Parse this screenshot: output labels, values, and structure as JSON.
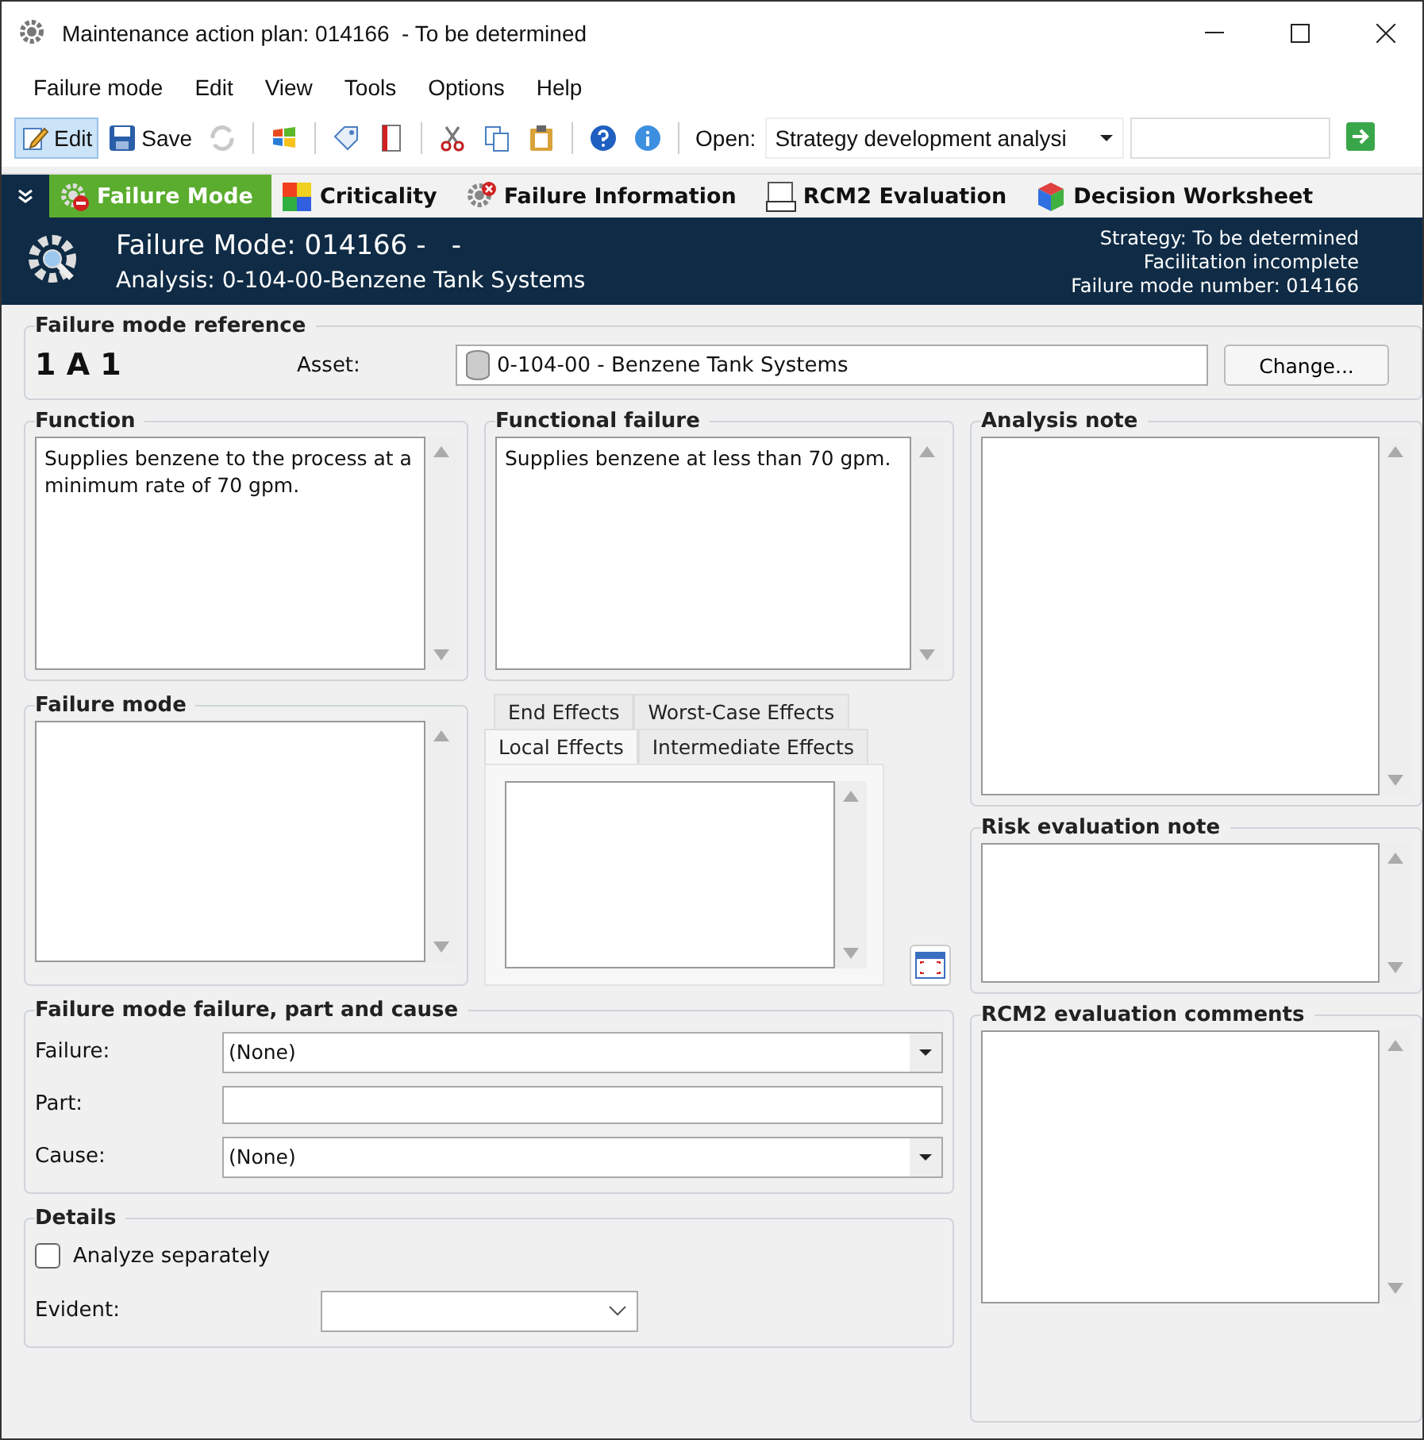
{
  "window": {
    "title": "Maintenance action plan: 014166  - To be determined"
  },
  "menu": [
    "Failure mode",
    "Edit",
    "View",
    "Tools",
    "Options",
    "Help"
  ],
  "toolbar": {
    "items": [
      {
        "kind": "button",
        "label": "Edit",
        "selected": true,
        "disabled": false
      },
      {
        "kind": "button",
        "label": "Save",
        "selected": false,
        "disabled": false
      },
      {
        "kind": "button",
        "selected": false,
        "disabled": true
      },
      {
        "kind": "separator"
      },
      {
        "kind": "button",
        "selected": false,
        "disabled": false
      },
      {
        "kind": "separator"
      },
      {
        "kind": "button",
        "selected": false,
        "disabled": false
      },
      {
        "kind": "button",
        "selected": false,
        "disabled": false
      },
      {
        "kind": "separator"
      },
      {
        "kind": "button",
        "selected": false,
        "disabled": false
      },
      {
        "kind": "button",
        "selected": false,
        "disabled": false
      },
      {
        "kind": "button",
        "selected": false,
        "disabled": false
      },
      {
        "kind": "separator"
      },
      {
        "kind": "button",
        "selected": false,
        "disabled": false
      },
      {
        "kind": "button",
        "selected": false,
        "disabled": false
      },
      {
        "kind": "separator"
      }
    ],
    "open_label": "Open:",
    "open_value": "Strategy development analysi"
  },
  "nav_tabs": [
    {
      "label": "Failure Mode",
      "selected": true
    },
    {
      "label": "Criticality",
      "selected": false
    },
    {
      "label": "Failure Information",
      "selected": false
    },
    {
      "label": "RCM2 Evaluation",
      "selected": false
    },
    {
      "label": "Decision Worksheet",
      "selected": false
    }
  ],
  "header": {
    "title": "Failure Mode: 014166 -   -",
    "subtitle": "Analysis: 0-104-00-Benzene Tank Systems",
    "status": [
      "Strategy: To be determined",
      "Facilitation incomplete",
      "Failure mode number: 014166"
    ]
  },
  "reference": {
    "title": "Failure mode reference",
    "code": "1 A 1",
    "asset_label": "Asset:",
    "asset": "0-104-00 - Benzene Tank Systems",
    "change_button": "Change..."
  },
  "function": {
    "title": "Function",
    "text": "Supplies benzene to the process at a minimum rate of 70 gpm."
  },
  "functional_failure": {
    "title": "Functional failure",
    "text": "Supplies benzene at less than 70 gpm."
  },
  "failure_mode": {
    "title": "Failure mode"
  },
  "effects_tabs": [
    {
      "label": "End Effects",
      "selected": false
    },
    {
      "label": "Worst-Case Effects",
      "selected": false
    },
    {
      "label": "Local Effects",
      "selected": true
    },
    {
      "label": "Intermediate Effects",
      "selected": false
    }
  ],
  "failure_part_cause": {
    "title": "Failure mode failure, part and cause",
    "fields": [
      {
        "label": "Failure:",
        "kind": "dropdown",
        "value": "(None)"
      },
      {
        "label": "Part:",
        "kind": "text"
      },
      {
        "label": "Cause:",
        "kind": "dropdown",
        "value": "(None)"
      }
    ]
  },
  "details": {
    "title": "Details",
    "analyze_separately": {
      "label": "Analyze separately",
      "checked": false
    },
    "evident_label": "Evident:"
  },
  "notes": [
    {
      "title": "Analysis note"
    },
    {
      "title": "Risk evaluation note"
    },
    {
      "title": "RCM2 evaluation comments"
    }
  ]
}
